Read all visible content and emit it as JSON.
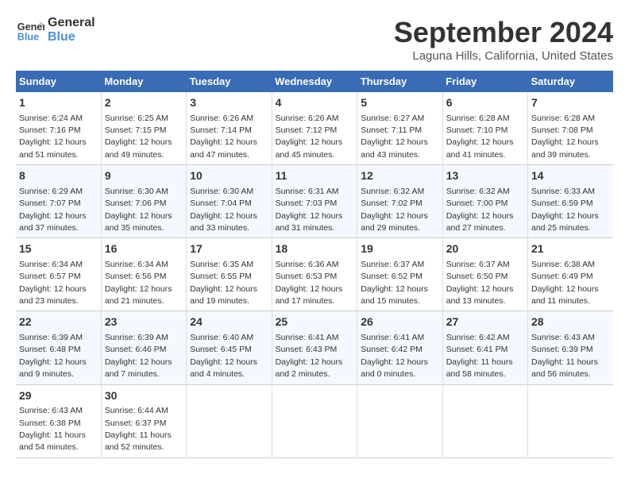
{
  "header": {
    "logo_line1": "General",
    "logo_line2": "Blue",
    "month_title": "September 2024",
    "location": "Laguna Hills, California, United States"
  },
  "days_of_week": [
    "Sunday",
    "Monday",
    "Tuesday",
    "Wednesday",
    "Thursday",
    "Friday",
    "Saturday"
  ],
  "weeks": [
    [
      {
        "day": "1",
        "sunrise": "6:24 AM",
        "sunset": "7:16 PM",
        "daylight": "12 hours and 51 minutes."
      },
      {
        "day": "2",
        "sunrise": "6:25 AM",
        "sunset": "7:15 PM",
        "daylight": "12 hours and 49 minutes."
      },
      {
        "day": "3",
        "sunrise": "6:26 AM",
        "sunset": "7:14 PM",
        "daylight": "12 hours and 47 minutes."
      },
      {
        "day": "4",
        "sunrise": "6:26 AM",
        "sunset": "7:12 PM",
        "daylight": "12 hours and 45 minutes."
      },
      {
        "day": "5",
        "sunrise": "6:27 AM",
        "sunset": "7:11 PM",
        "daylight": "12 hours and 43 minutes."
      },
      {
        "day": "6",
        "sunrise": "6:28 AM",
        "sunset": "7:10 PM",
        "daylight": "12 hours and 41 minutes."
      },
      {
        "day": "7",
        "sunrise": "6:28 AM",
        "sunset": "7:08 PM",
        "daylight": "12 hours and 39 minutes."
      }
    ],
    [
      {
        "day": "8",
        "sunrise": "6:29 AM",
        "sunset": "7:07 PM",
        "daylight": "12 hours and 37 minutes."
      },
      {
        "day": "9",
        "sunrise": "6:30 AM",
        "sunset": "7:06 PM",
        "daylight": "12 hours and 35 minutes."
      },
      {
        "day": "10",
        "sunrise": "6:30 AM",
        "sunset": "7:04 PM",
        "daylight": "12 hours and 33 minutes."
      },
      {
        "day": "11",
        "sunrise": "6:31 AM",
        "sunset": "7:03 PM",
        "daylight": "12 hours and 31 minutes."
      },
      {
        "day": "12",
        "sunrise": "6:32 AM",
        "sunset": "7:02 PM",
        "daylight": "12 hours and 29 minutes."
      },
      {
        "day": "13",
        "sunrise": "6:32 AM",
        "sunset": "7:00 PM",
        "daylight": "12 hours and 27 minutes."
      },
      {
        "day": "14",
        "sunrise": "6:33 AM",
        "sunset": "6:59 PM",
        "daylight": "12 hours and 25 minutes."
      }
    ],
    [
      {
        "day": "15",
        "sunrise": "6:34 AM",
        "sunset": "6:57 PM",
        "daylight": "12 hours and 23 minutes."
      },
      {
        "day": "16",
        "sunrise": "6:34 AM",
        "sunset": "6:56 PM",
        "daylight": "12 hours and 21 minutes."
      },
      {
        "day": "17",
        "sunrise": "6:35 AM",
        "sunset": "6:55 PM",
        "daylight": "12 hours and 19 minutes."
      },
      {
        "day": "18",
        "sunrise": "6:36 AM",
        "sunset": "6:53 PM",
        "daylight": "12 hours and 17 minutes."
      },
      {
        "day": "19",
        "sunrise": "6:37 AM",
        "sunset": "6:52 PM",
        "daylight": "12 hours and 15 minutes."
      },
      {
        "day": "20",
        "sunrise": "6:37 AM",
        "sunset": "6:50 PM",
        "daylight": "12 hours and 13 minutes."
      },
      {
        "day": "21",
        "sunrise": "6:38 AM",
        "sunset": "6:49 PM",
        "daylight": "12 hours and 11 minutes."
      }
    ],
    [
      {
        "day": "22",
        "sunrise": "6:39 AM",
        "sunset": "6:48 PM",
        "daylight": "12 hours and 9 minutes."
      },
      {
        "day": "23",
        "sunrise": "6:39 AM",
        "sunset": "6:46 PM",
        "daylight": "12 hours and 7 minutes."
      },
      {
        "day": "24",
        "sunrise": "6:40 AM",
        "sunset": "6:45 PM",
        "daylight": "12 hours and 4 minutes."
      },
      {
        "day": "25",
        "sunrise": "6:41 AM",
        "sunset": "6:43 PM",
        "daylight": "12 hours and 2 minutes."
      },
      {
        "day": "26",
        "sunrise": "6:41 AM",
        "sunset": "6:42 PM",
        "daylight": "12 hours and 0 minutes."
      },
      {
        "day": "27",
        "sunrise": "6:42 AM",
        "sunset": "6:41 PM",
        "daylight": "11 hours and 58 minutes."
      },
      {
        "day": "28",
        "sunrise": "6:43 AM",
        "sunset": "6:39 PM",
        "daylight": "11 hours and 56 minutes."
      }
    ],
    [
      {
        "day": "29",
        "sunrise": "6:43 AM",
        "sunset": "6:38 PM",
        "daylight": "11 hours and 54 minutes."
      },
      {
        "day": "30",
        "sunrise": "6:44 AM",
        "sunset": "6:37 PM",
        "daylight": "11 hours and 52 minutes."
      },
      null,
      null,
      null,
      null,
      null
    ]
  ],
  "labels": {
    "sunrise": "Sunrise:",
    "sunset": "Sunset:",
    "daylight": "Daylight:"
  }
}
